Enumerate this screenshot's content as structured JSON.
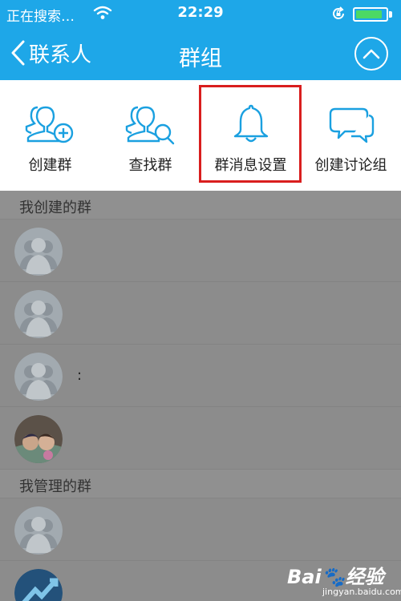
{
  "status": {
    "carrier": "正在搜索…",
    "time": "22:29",
    "battery_level": 0.9
  },
  "nav": {
    "back_label": "联系人",
    "title": "群组"
  },
  "actions": [
    {
      "label": "创建群",
      "icon": "group-add-icon"
    },
    {
      "label": "查找群",
      "icon": "group-search-icon"
    },
    {
      "label": "群消息设置",
      "icon": "bell-icon"
    },
    {
      "label": "创建讨论组",
      "icon": "chat-bubble-icon"
    }
  ],
  "sections": [
    {
      "title": "我创建的群",
      "rows": [
        {
          "avatar": "default-group-avatar",
          "text": ""
        },
        {
          "avatar": "default-group-avatar",
          "text": ""
        },
        {
          "avatar": "default-group-avatar",
          "text": ":"
        },
        {
          "avatar": "photo-avatar",
          "text": ""
        }
      ]
    },
    {
      "title": "我管理的群",
      "rows": [
        {
          "avatar": "default-group-avatar",
          "text": ""
        },
        {
          "avatar": "blue-logo-avatar",
          "text": ""
        }
      ]
    }
  ],
  "watermark": {
    "brand": "Bai",
    "suffix": "经验",
    "url": "jingyan.baidu.com"
  },
  "colors": {
    "accent": "#1ea7e8",
    "icon_blue": "#1aa0e0",
    "highlight": "#d91e1e",
    "overlay": "#8c8c8c"
  }
}
